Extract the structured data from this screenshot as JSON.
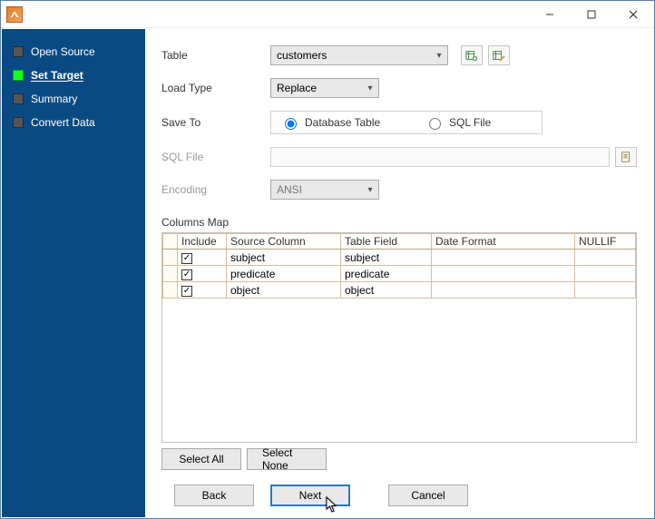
{
  "sidebar": {
    "items": [
      {
        "label": "Open Source",
        "active": false
      },
      {
        "label": "Set Target",
        "active": true
      },
      {
        "label": "Summary",
        "active": false
      },
      {
        "label": "Convert Data",
        "active": false
      }
    ]
  },
  "form": {
    "table_label": "Table",
    "table_value": "customers",
    "loadtype_label": "Load Type",
    "loadtype_value": "Replace",
    "saveto_label": "Save To",
    "saveto_options": {
      "db": "Database Table",
      "sql": "SQL File"
    },
    "saveto_selected": "db",
    "sqlfile_label": "SQL File",
    "sqlfile_value": "",
    "encoding_label": "Encoding",
    "encoding_value": "ANSI",
    "columns_label": "Columns Map"
  },
  "grid": {
    "headers": {
      "include": "Include",
      "source": "Source Column",
      "target": "Table Field",
      "datefmt": "Date Format",
      "nullif": "NULLIF"
    },
    "rows": [
      {
        "include": true,
        "source": "subject",
        "target": "subject",
        "datefmt": "",
        "nullif": ""
      },
      {
        "include": true,
        "source": "predicate",
        "target": "predicate",
        "datefmt": "",
        "nullif": ""
      },
      {
        "include": true,
        "source": "object",
        "target": "object",
        "datefmt": "",
        "nullif": ""
      }
    ]
  },
  "buttons": {
    "select_all": "Select All",
    "select_none": "Select None",
    "back": "Back",
    "next": "Next",
    "cancel": "Cancel"
  }
}
